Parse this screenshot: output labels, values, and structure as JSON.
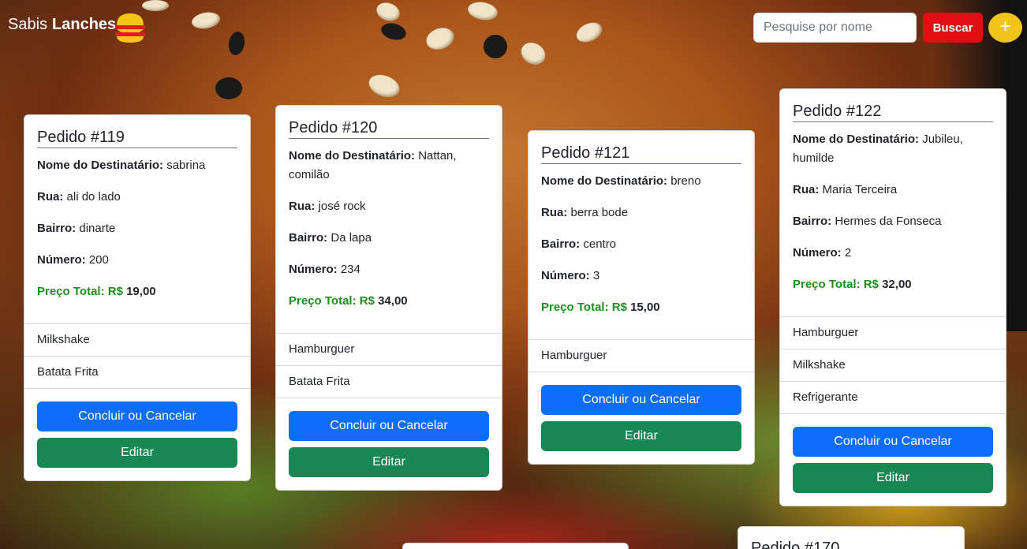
{
  "navbar": {
    "brand_prefix": "Sabis",
    "brand_bold": "Lanches",
    "search_placeholder": "Pesquise por nome",
    "search_button": "Buscar",
    "add_button": "+"
  },
  "labels": {
    "name": "Nome do Destinatário:",
    "street": "Rua:",
    "district": "Bairro:",
    "number": "Número:",
    "total": "Preço Total: R$",
    "finish": "Concluir ou Cancelar",
    "edit": "Editar"
  },
  "orders": [
    {
      "title": "Pedido #119",
      "name": "sabrina",
      "street": "ali do lado",
      "district": "dinarte",
      "number": "200",
      "total": "19,00",
      "items": [
        "Milkshake",
        "Batata Frita"
      ]
    },
    {
      "title": "Pedido #120",
      "name": "Nattan, comilão",
      "street": "josé rock",
      "district": "Da lapa",
      "number": "234",
      "total": "34,00",
      "items": [
        "Hamburguer",
        "Batata Frita"
      ]
    },
    {
      "title": "Pedido #121",
      "name": "breno",
      "street": "berra bode",
      "district": "centro",
      "number": "3",
      "total": "15,00",
      "items": [
        "Hamburguer"
      ]
    },
    {
      "title": "Pedido #122",
      "name": "Jubileu, humilde",
      "street": "Maria Terceira",
      "district": "Hermes da Fonseca",
      "number": "2",
      "total": "32,00",
      "items": [
        "Hamburguer",
        "Milkshake",
        "Refrigerante"
      ]
    }
  ],
  "partial_cards": [
    {
      "title": "Pedido #170"
    }
  ],
  "colors": {
    "buscar": "#e30d12",
    "add": "#f0c419",
    "primary": "#0d6efd",
    "success": "#198754",
    "price": "#1e8e1e"
  }
}
